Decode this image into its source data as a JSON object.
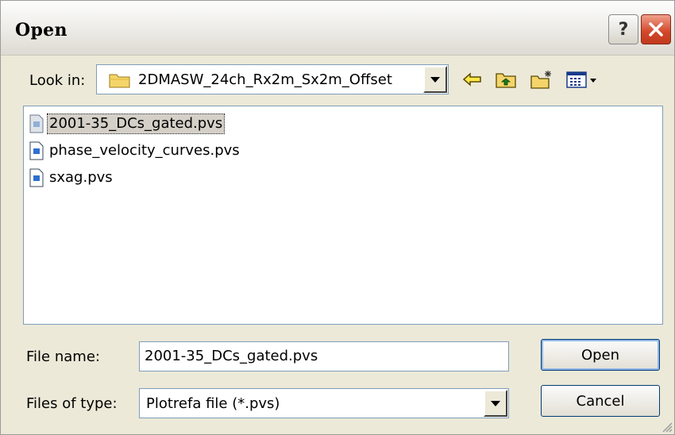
{
  "window": {
    "title": "Open"
  },
  "lookin": {
    "label": "Look in:",
    "value": "2DMASW_24ch_Rx2m_Sx2m_Offset"
  },
  "files": [
    {
      "name": "2001-35_DCs_gated.pvs"
    },
    {
      "name": "phase_velocity_curves.pvs"
    },
    {
      "name": "sxag.pvs"
    }
  ],
  "filename": {
    "label": "File name:",
    "value": "2001-35_DCs_gated.pvs"
  },
  "filetype": {
    "label": "Files of type:",
    "value": "Plotrefa file (*.pvs)"
  },
  "buttons": {
    "open": "Open",
    "cancel": "Cancel"
  },
  "colors": {
    "selection": "#d4d0c8",
    "field_border": "#7f9db9",
    "dialog_bg": "#ece9d8",
    "close_red": "#d2462a"
  },
  "icons": [
    "question-icon",
    "close-icon",
    "folder-icon",
    "back-icon",
    "up-folder-icon",
    "new-folder-icon",
    "view-menu-icon",
    "file-icon",
    "resize-grip-icon"
  ]
}
